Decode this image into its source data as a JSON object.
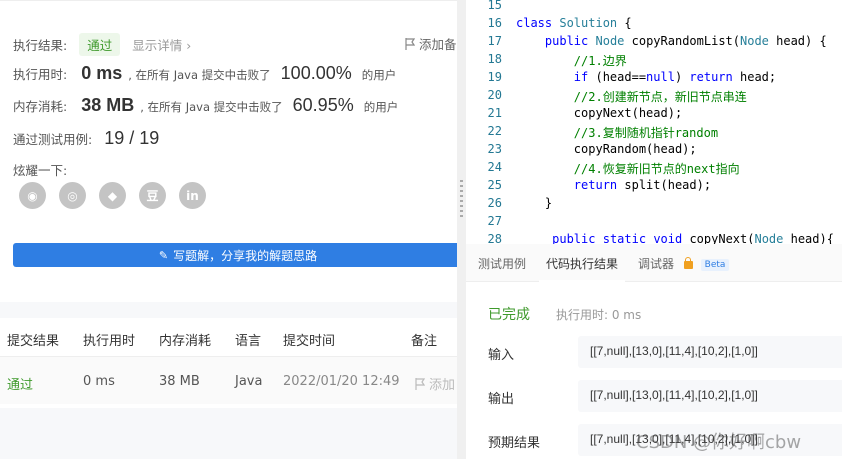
{
  "summary": {
    "result_label": "执行结果:",
    "result_badge": "通过",
    "detail_link": "显示详情 ›",
    "add_note": "添加备",
    "runtime_label": "执行用时:",
    "runtime_value": "0 ms",
    "runtime_text": ", 在所有 Java 提交中击败了",
    "runtime_pct": "100.00%",
    "runtime_suffix": "的用户",
    "memory_label": "内存消耗:",
    "memory_value": "38 MB",
    "memory_text": ", 在所有 Java 提交中击败了",
    "memory_pct": "60.95%",
    "memory_suffix": "的用户",
    "tests_label": "通过测试用例:",
    "tests_value": "19 / 19",
    "share_label": "炫耀一下:",
    "share_icons": [
      "wechat-icon",
      "weibo-icon",
      "qq-icon",
      "douban-icon",
      "linkedin-icon"
    ],
    "share_glyphs": [
      "◉",
      "◎",
      "◆",
      "豆",
      "in"
    ],
    "write_button": "写题解，分享我的解题思路"
  },
  "submissions": {
    "headers": [
      "提交结果",
      "执行用时",
      "内存消耗",
      "语言",
      "提交时间",
      "备注"
    ],
    "row": {
      "result": "通过",
      "runtime": "0 ms",
      "memory": "38 MB",
      "language": "Java",
      "time": "2022/01/20 12:49",
      "note": "添加"
    }
  },
  "editor": {
    "lines": [
      {
        "n": "15",
        "code": ""
      },
      {
        "n": "16",
        "code": "class Solution {"
      },
      {
        "n": "17",
        "code": "    public Node copyRandomList(Node head) {"
      },
      {
        "n": "18",
        "code": "        //1.边界"
      },
      {
        "n": "19",
        "code": "        if (head==null) return head;"
      },
      {
        "n": "20",
        "code": "        //2.创建新节点，新旧节点串连"
      },
      {
        "n": "21",
        "code": "        copyNext(head);"
      },
      {
        "n": "22",
        "code": "        //3.复制随机指针random"
      },
      {
        "n": "23",
        "code": "        copyRandom(head);"
      },
      {
        "n": "24",
        "code": "        //4.恢复新旧节点的next指向"
      },
      {
        "n": "25",
        "code": "        return split(head);"
      },
      {
        "n": "26",
        "code": "    }"
      },
      {
        "n": "27",
        "code": ""
      },
      {
        "n": "28",
        "code": "     public static void copyNext(Node head){"
      }
    ]
  },
  "tabs": {
    "test_case": "测试用例",
    "run_result": "代码执行结果",
    "debugger": "调试器",
    "beta": "Beta"
  },
  "run": {
    "status": "已完成",
    "exec_time": "执行用时: 0 ms",
    "input_label": "输入",
    "input_value": "[[7,null],[13,0],[11,4],[10,2],[1,0]]",
    "output_label": "输出",
    "output_value": "[[7,null],[13,0],[11,4],[10,2],[1,0]]",
    "expected_label": "预期结果",
    "expected_value": "[[7,null],[13,0],[11,4],[10,2],[1,0]]"
  },
  "watermark": "CSDN @你好啊cbw"
}
